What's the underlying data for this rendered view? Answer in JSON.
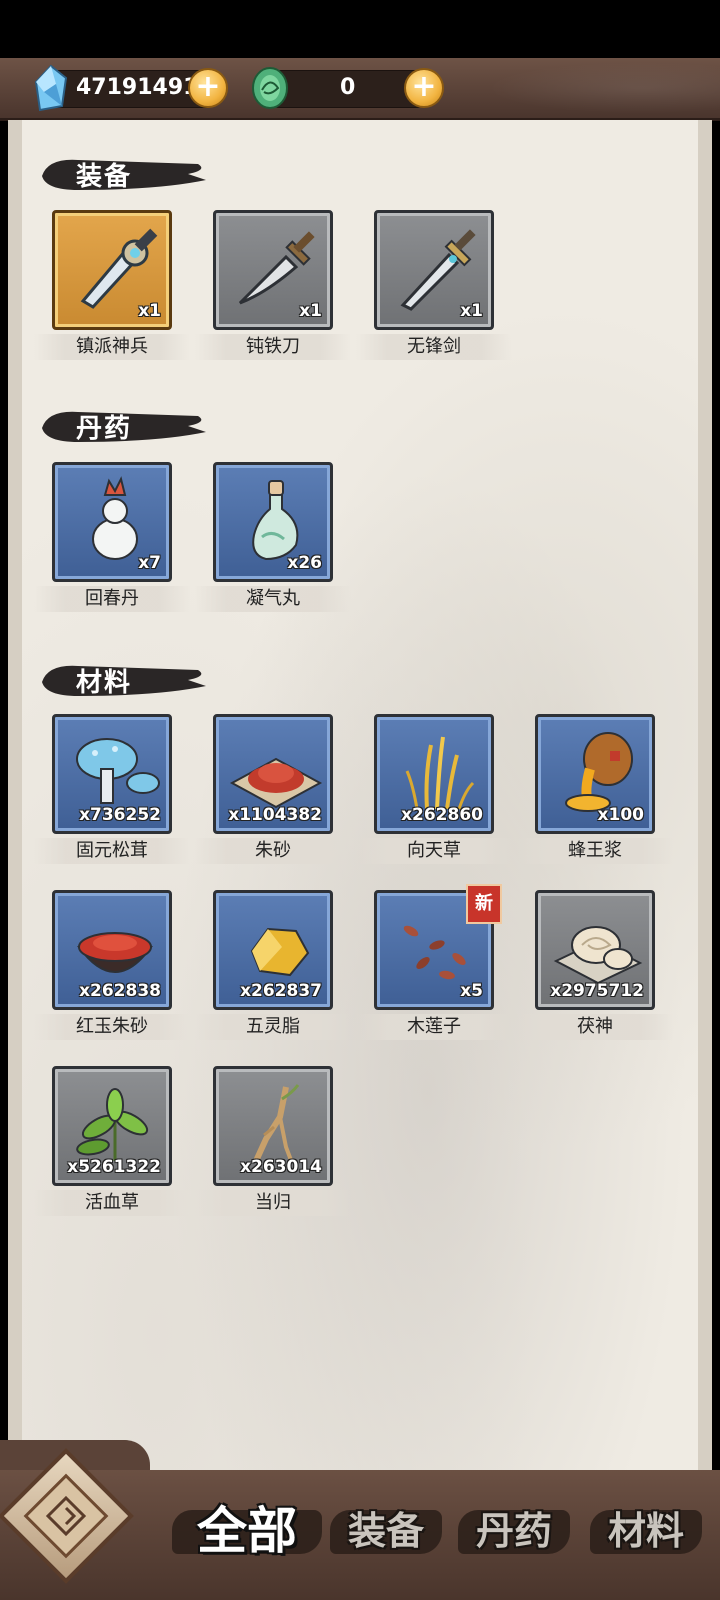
{
  "currency": {
    "gem_icon": "blue-crystal-icon",
    "gem_value": "47191491",
    "jade_icon": "green-jade-icon",
    "jade_value": "0",
    "plus_symbol": "+"
  },
  "sections": {
    "equipment": {
      "title": "装备",
      "items": [
        {
          "name": "镇派神兵",
          "count": "x1",
          "icon": "ornate-sword-icon",
          "rarity": "gold"
        },
        {
          "name": "钝铁刀",
          "count": "x1",
          "icon": "iron-blade-icon",
          "rarity": "gray"
        },
        {
          "name": "无锋剑",
          "count": "x1",
          "icon": "bladeless-sword-icon",
          "rarity": "gray"
        }
      ]
    },
    "pills": {
      "title": "丹药",
      "items": [
        {
          "name": "回春丹",
          "count": "x7",
          "icon": "gourd-bottle-icon",
          "rarity": "blue"
        },
        {
          "name": "凝气丸",
          "count": "x26",
          "icon": "jade-vial-icon",
          "rarity": "blue"
        }
      ]
    },
    "materials": {
      "title": "材料",
      "items": [
        {
          "name": "固元松茸",
          "count": "x736252",
          "icon": "mushroom-icon",
          "rarity": "blue"
        },
        {
          "name": "朱砂",
          "count": "x1104382",
          "icon": "cinnabar-powder-icon",
          "rarity": "blue"
        },
        {
          "name": "向天草",
          "count": "x262860",
          "icon": "golden-grass-icon",
          "rarity": "blue"
        },
        {
          "name": "蜂王浆",
          "count": "x100",
          "icon": "royal-jelly-icon",
          "rarity": "blue"
        },
        {
          "name": "红玉朱砂",
          "count": "x262838",
          "icon": "red-powder-bowl-icon",
          "rarity": "blue"
        },
        {
          "name": "五灵脂",
          "count": "x262837",
          "icon": "amber-crystal-icon",
          "rarity": "blue"
        },
        {
          "name": "木莲子",
          "count": "x5",
          "icon": "lotus-seed-icon",
          "rarity": "blue",
          "badge": "新"
        },
        {
          "name": "茯神",
          "count": "x2975712",
          "icon": "fungus-icon",
          "rarity": "gray"
        },
        {
          "name": "活血草",
          "count": "x5261322",
          "icon": "herb-leaves-icon",
          "rarity": "gray"
        },
        {
          "name": "当归",
          "count": "x263014",
          "icon": "angelica-root-icon",
          "rarity": "gray"
        }
      ]
    }
  },
  "bottom_nav": {
    "home_icon": "diamond-home-icon",
    "tabs": [
      {
        "label": "全部",
        "active": true
      },
      {
        "label": "装备",
        "active": false
      },
      {
        "label": "丹药",
        "active": false
      },
      {
        "label": "材料",
        "active": false
      }
    ]
  }
}
